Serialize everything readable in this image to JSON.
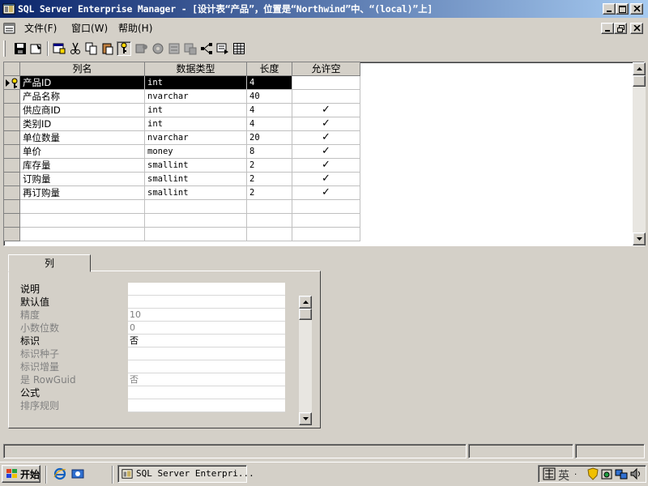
{
  "window": {
    "title": "SQL Server Enterprise Manager - [设计表“产品”，位置是“Northwind”中、“(local)”上]",
    "icon": "enterprise-manager-icon"
  },
  "menu": {
    "items": [
      {
        "label": "文件(F)"
      },
      {
        "label": "窗口(W)"
      },
      {
        "label": "帮助(H)"
      }
    ]
  },
  "toolbar": {
    "buttons": [
      "save-icon",
      "properties-icon",
      "design-table-icon",
      "cut-icon",
      "copy-icon",
      "paste-icon",
      "primary-key-icon",
      "table-permissions-icon",
      "manage-triggers-icon",
      "manage-indexes-icon",
      "manage-constraints-icon",
      "manage-relationships-icon",
      "view-sql-icon",
      "grid-icon"
    ]
  },
  "grid": {
    "columns": [
      "列名",
      "数据类型",
      "长度",
      "允许空"
    ],
    "rows": [
      {
        "name": "产品ID",
        "type": "int",
        "length": "4",
        "nullable": ""
      },
      {
        "name": "产品名称",
        "type": "nvarchar",
        "length": "40",
        "nullable": ""
      },
      {
        "name": "供应商ID",
        "type": "int",
        "length": "4",
        "nullable": "✓"
      },
      {
        "name": "类别ID",
        "type": "int",
        "length": "4",
        "nullable": "✓"
      },
      {
        "name": "单位数量",
        "type": "nvarchar",
        "length": "20",
        "nullable": "✓"
      },
      {
        "name": "单价",
        "type": "money",
        "length": "8",
        "nullable": "✓"
      },
      {
        "name": "库存量",
        "type": "smallint",
        "length": "2",
        "nullable": "✓"
      },
      {
        "name": "订购量",
        "type": "smallint",
        "length": "2",
        "nullable": "✓"
      },
      {
        "name": "再订购量",
        "type": "smallint",
        "length": "2",
        "nullable": "✓"
      }
    ],
    "selected_row": 0
  },
  "properties": {
    "tab_label": "列",
    "items": [
      {
        "label": "说明",
        "value": "",
        "disabled": false
      },
      {
        "label": "默认值",
        "value": "",
        "disabled": false
      },
      {
        "label": "精度",
        "value": "10",
        "disabled": true
      },
      {
        "label": "小数位数",
        "value": "0",
        "disabled": true
      },
      {
        "label": "标识",
        "value": "否",
        "disabled": false
      },
      {
        "label": "标识种子",
        "value": "",
        "disabled": true
      },
      {
        "label": "标识增量",
        "value": "",
        "disabled": true
      },
      {
        "label": "是 RowGuid",
        "value": "否",
        "disabled": true
      },
      {
        "label": "公式",
        "value": "",
        "disabled": false
      },
      {
        "label": "排序规则",
        "value": "",
        "disabled": true
      }
    ]
  },
  "taskbar": {
    "start_label": "开始",
    "task_label": "SQL Server Enterpri...",
    "ime_label": "英"
  }
}
